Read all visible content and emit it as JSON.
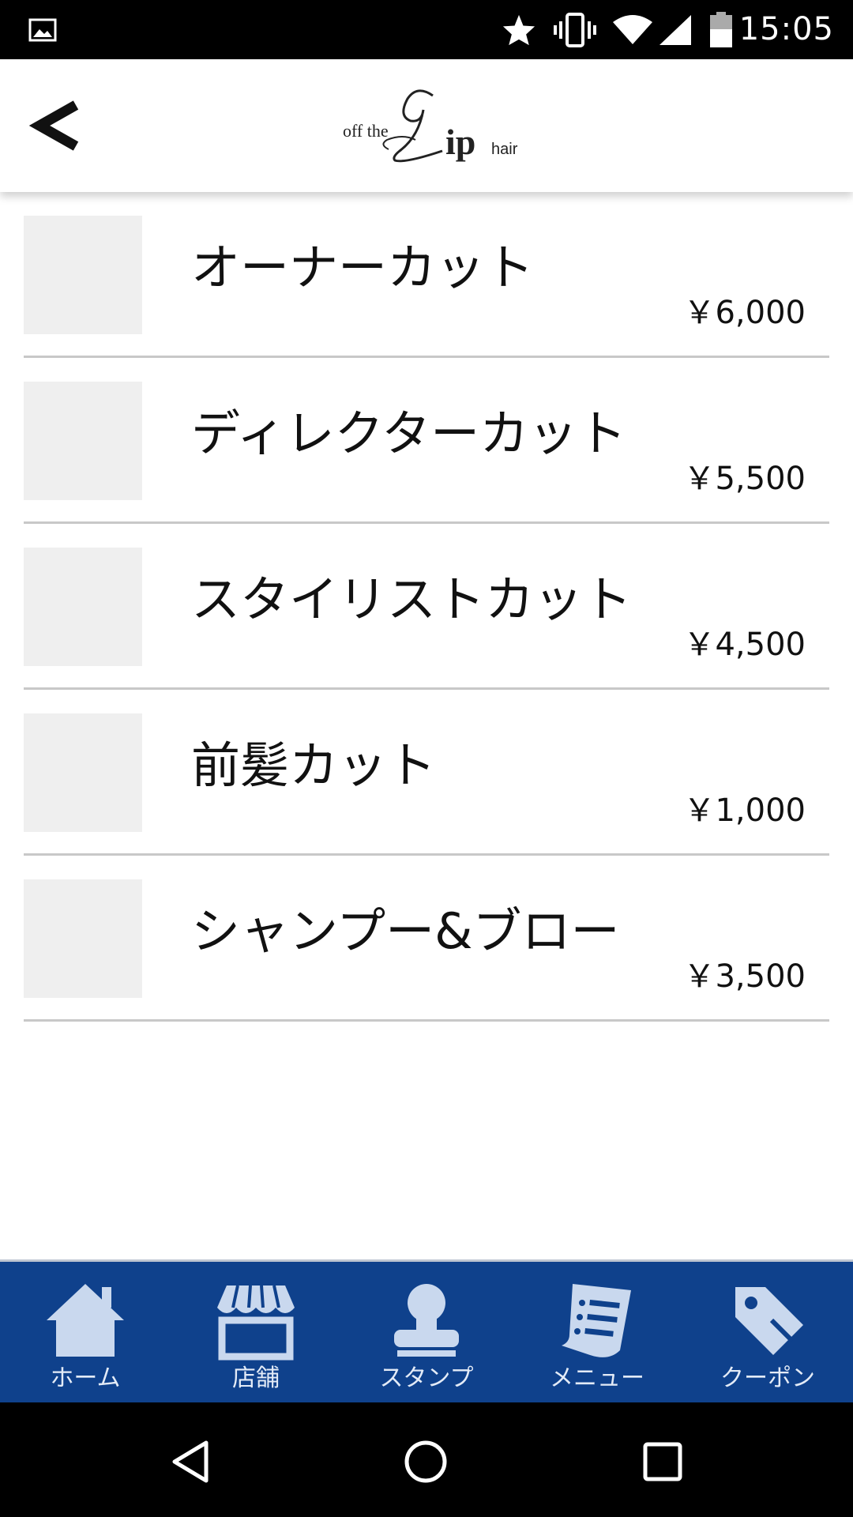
{
  "status_bar": {
    "time": "15:05",
    "icons": [
      "image-icon",
      "star-icon",
      "vibrate-icon",
      "wifi-icon",
      "signal-icon",
      "battery-icon"
    ]
  },
  "header": {
    "logo_text": "off the Lip hair"
  },
  "menu": {
    "items": [
      {
        "name": "オーナーカット",
        "price": "￥6,000"
      },
      {
        "name": "ディレクターカット",
        "price": "￥5,500"
      },
      {
        "name": "スタイリストカット",
        "price": "￥4,500"
      },
      {
        "name": "前髪カット",
        "price": "￥1,000"
      },
      {
        "name": "シャンプー&ブロー",
        "price": "￥3,500"
      }
    ]
  },
  "tabs": [
    {
      "label": "ホーム",
      "icon": "home-icon"
    },
    {
      "label": "店舗",
      "icon": "store-icon"
    },
    {
      "label": "スタンプ",
      "icon": "stamp-icon"
    },
    {
      "label": "メニュー",
      "icon": "menu-icon"
    },
    {
      "label": "クーポン",
      "icon": "coupon-icon"
    }
  ],
  "colors": {
    "tab_bar_bg": "#0f418c",
    "tab_icon": "#c9d8ee",
    "thumb_bg": "#efefef",
    "divider": "#c8c8c8"
  }
}
